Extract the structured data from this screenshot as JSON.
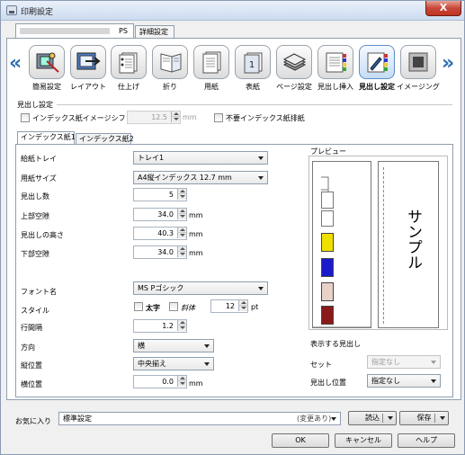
{
  "window": {
    "title": "印刷設定",
    "close_glyph": "X"
  },
  "top_tabs": [
    {
      "label": "PS"
    },
    {
      "label": "詳細設定"
    }
  ],
  "ribbon": {
    "items": [
      {
        "label": "簡易設定",
        "icon": "quick-setup-icon"
      },
      {
        "label": "レイアウト",
        "icon": "layout-icon"
      },
      {
        "label": "仕上げ",
        "icon": "finishing-icon"
      },
      {
        "label": "折り",
        "icon": "fold-icon"
      },
      {
        "label": "用紙",
        "icon": "paper-icon"
      },
      {
        "label": "表紙",
        "icon": "cover-icon"
      },
      {
        "label": "ページ設定",
        "icon": "page-settings-icon"
      },
      {
        "label": "見出し挿入",
        "icon": "tab-insert-icon"
      },
      {
        "label": "見出し設定",
        "icon": "tab-settings-icon",
        "active": true
      },
      {
        "label": "イメージング",
        "icon": "imaging-icon"
      }
    ],
    "prev_glyph": "«",
    "next_glyph": "»"
  },
  "section": {
    "title": "見出し設定"
  },
  "shift": {
    "label": "インデックス紙イメージシフト",
    "value": "12.5",
    "unit": "mm"
  },
  "discard": {
    "label": "不要インデックス紙排紙"
  },
  "inner_tabs": [
    "インデックス紙1",
    "インデックス紙2"
  ],
  "form": {
    "tray": {
      "label": "給紙トレイ",
      "value": "トレイ1"
    },
    "size": {
      "label": "用紙サイズ",
      "value": "A4縦インデックス 12.7 mm"
    },
    "count": {
      "label": "見出し数",
      "value": "5"
    },
    "top": {
      "label": "上部空隙",
      "value": "34.0",
      "unit": "mm"
    },
    "height": {
      "label": "見出しの高さ",
      "value": "40.3",
      "unit": "mm"
    },
    "bottom": {
      "label": "下部空隙",
      "value": "34.0",
      "unit": "mm"
    },
    "font": {
      "label": "フォント名",
      "value": "MS Pゴシック"
    },
    "style": {
      "label": "スタイル",
      "bold": "太字",
      "italic": "斜体",
      "size": "12",
      "unit": "pt"
    },
    "spacing": {
      "label": "行間隔",
      "value": "1.2"
    },
    "direction": {
      "label": "方向",
      "value": "横"
    },
    "vpos": {
      "label": "縦位置",
      "value": "中央揃え"
    },
    "hpos": {
      "label": "横位置",
      "value": "0.0",
      "unit": "mm"
    }
  },
  "preview": {
    "title": "プレビュー",
    "sample": "サンプル",
    "tab_colors": [
      "#ffffff",
      "#ffffff",
      "#f0e000",
      "#1a1acc",
      "#e8d2c8",
      "#8a1a1a"
    ]
  },
  "display": {
    "title": "表示する見出し",
    "set_label": "セット",
    "set_value": "指定なし",
    "pos_label": "見出し位置",
    "pos_value": "指定なし"
  },
  "favorites": {
    "label": "お気に入り",
    "value": "標準設定",
    "changed": "(変更あり)",
    "load": "読込",
    "save": "保存"
  },
  "footer": {
    "ok": "OK",
    "cancel": "キャンセル",
    "help": "ヘルプ"
  }
}
